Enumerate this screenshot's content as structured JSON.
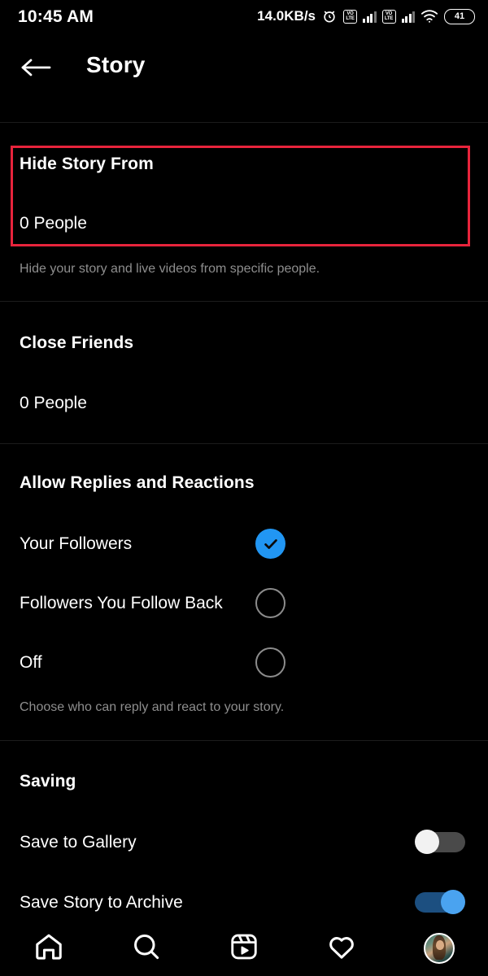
{
  "status_bar": {
    "time": "10:45 AM",
    "network_speed": "14.0KB/s",
    "alarm_icon": "alarm-clock-icon",
    "volte_label_top": "VO",
    "volte_label_bottom": "LTE",
    "sim1_icon": "volte-signal-icon",
    "sim2_icon": "volte-signal-icon",
    "wifi_icon": "wifi-icon",
    "battery_level": "41"
  },
  "header": {
    "back_icon": "back-arrow-icon",
    "title": "Story"
  },
  "sections": {
    "hide_story": {
      "title": "Hide Story From",
      "value": "0 People",
      "helper": "Hide your story and live videos from specific people.",
      "highlight_color": "#e8243c"
    },
    "close_friends": {
      "title": "Close Friends",
      "value": "0 People"
    },
    "allow_replies": {
      "title": "Allow Replies and Reactions",
      "helper": "Choose who can reply and react to your story.",
      "options": [
        {
          "label": "Your Followers",
          "selected": true
        },
        {
          "label": "Followers You Follow Back",
          "selected": false
        },
        {
          "label": "Off",
          "selected": false
        }
      ],
      "selected_color": "#2196f3",
      "check_icon": "checkmark-icon"
    },
    "saving": {
      "title": "Saving",
      "toggles": [
        {
          "label": "Save to Gallery",
          "on": false
        },
        {
          "label": "Save Story to Archive",
          "on": true
        }
      ],
      "on_color": "#4aa3f0",
      "off_color": "#4a4a4a"
    }
  },
  "bottom_nav": {
    "items": [
      {
        "name": "home-icon",
        "label": "Home"
      },
      {
        "name": "search-icon",
        "label": "Search"
      },
      {
        "name": "reels-icon",
        "label": "Reels"
      },
      {
        "name": "heart-icon",
        "label": "Activity"
      },
      {
        "name": "profile-avatar",
        "label": "Profile"
      }
    ]
  }
}
